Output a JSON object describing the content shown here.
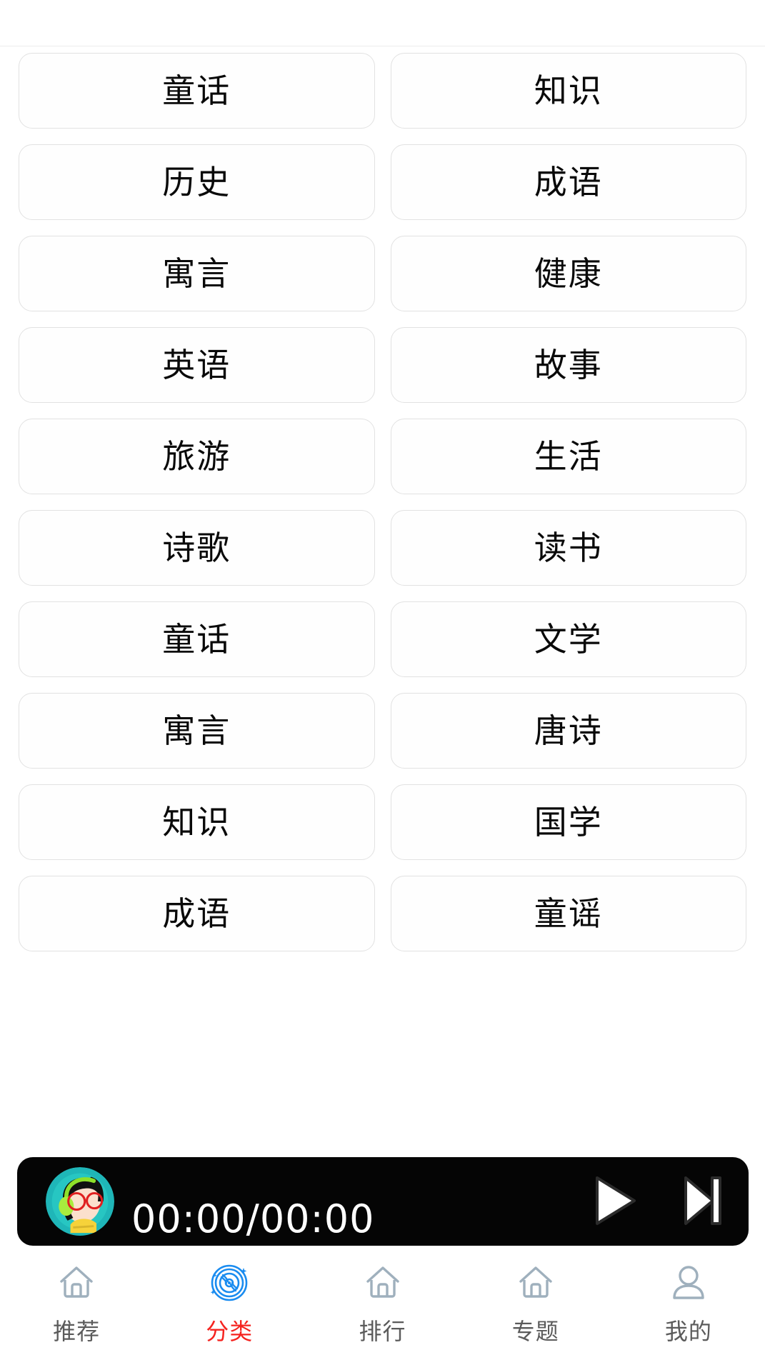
{
  "app": {
    "background_color": "#ffffff",
    "accent_active_color": "#f5231f",
    "accent_icon_color": "#1a8cf0",
    "card_border_color": "#e2e2e2",
    "nav_icon_color": "#9fb0bd"
  },
  "categories": [
    {
      "label": "童话"
    },
    {
      "label": "知识"
    },
    {
      "label": "历史"
    },
    {
      "label": "成语"
    },
    {
      "label": "寓言"
    },
    {
      "label": "健康"
    },
    {
      "label": "英语"
    },
    {
      "label": "故事"
    },
    {
      "label": "旅游"
    },
    {
      "label": "生活"
    },
    {
      "label": "诗歌"
    },
    {
      "label": "读书"
    },
    {
      "label": "童话"
    },
    {
      "label": "文学"
    },
    {
      "label": "寓言"
    },
    {
      "label": "唐诗"
    },
    {
      "label": "知识"
    },
    {
      "label": "国学"
    },
    {
      "label": "成语"
    },
    {
      "label": "童谣"
    }
  ],
  "player": {
    "time_display": "00:00/00:00",
    "avatar_icon": "girl-headphones-avatar",
    "play_icon": "play-icon",
    "next_icon": "next-track-icon",
    "background_color": "#050505"
  },
  "bottom_nav": {
    "items": [
      {
        "label": "推荐",
        "icon": "home-icon",
        "active": false
      },
      {
        "label": "分类",
        "icon": "disc-icon",
        "active": true
      },
      {
        "label": "排行",
        "icon": "home-icon",
        "active": false
      },
      {
        "label": "专题",
        "icon": "home-icon",
        "active": false
      },
      {
        "label": "我的",
        "icon": "person-icon",
        "active": false
      }
    ]
  }
}
